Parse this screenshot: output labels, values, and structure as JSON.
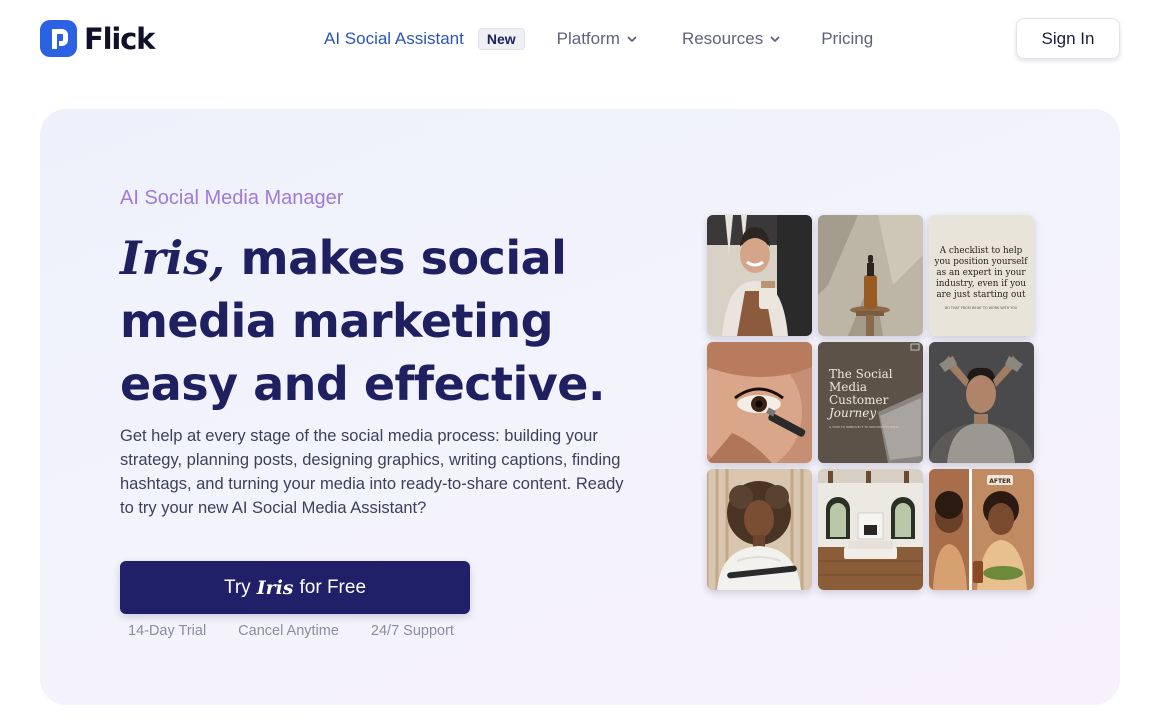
{
  "brand": {
    "name": "Flick",
    "accent": "#2b62e3"
  },
  "nav": {
    "items": [
      {
        "label": "AI Social Assistant",
        "badge": "New"
      },
      {
        "label": "Platform"
      },
      {
        "label": "Resources"
      },
      {
        "label": "Pricing"
      }
    ],
    "signin_label": "Sign In"
  },
  "hero": {
    "eyebrow": "AI Social Media Manager",
    "headline_name": "Iris,",
    "headline_rest": " makes social media marketing easy and effective.",
    "description": "Get help at every stage of the social media process: building your strategy, planning posts, designing graphics, writing captions, finding hashtags, and turning your media into ready-to-share content. Ready to try your new AI Social Media Assistant?",
    "cta": {
      "prefix": "Try",
      "name": "Iris",
      "suffix": "for Free"
    },
    "perks": [
      "14-Day Trial",
      "Cancel Anytime",
      "24/7 Support"
    ],
    "colors": {
      "heading": "#1e2060",
      "eyebrow": "#a07ad4",
      "cta_bg": "#1f2067"
    }
  },
  "gallery": {
    "tiles": [
      {
        "name": "barista-photo"
      },
      {
        "name": "serum-bottle-photo"
      },
      {
        "name": "checklist-post",
        "lines": [
          "A checklist to help",
          "you position yourself",
          "as an expert in your",
          "industry, even if you",
          "are just starting out"
        ],
        "footer": "DO THAT FROM WHAT TO WORK WITH YOU"
      },
      {
        "name": "makeup-closeup-photo"
      },
      {
        "name": "customer-journey-post",
        "lines": [
          "The Social",
          "Media",
          "Customer",
          "Journey"
        ],
        "subtitle": "& HOW TO IMPROVE IT TO WIN MORE CLIENTS"
      },
      {
        "name": "man-portrait-photo"
      },
      {
        "name": "woman-portrait-photo"
      },
      {
        "name": "interior-room-photo"
      },
      {
        "name": "before-after-illustration",
        "tag": "AFTER"
      }
    ]
  }
}
